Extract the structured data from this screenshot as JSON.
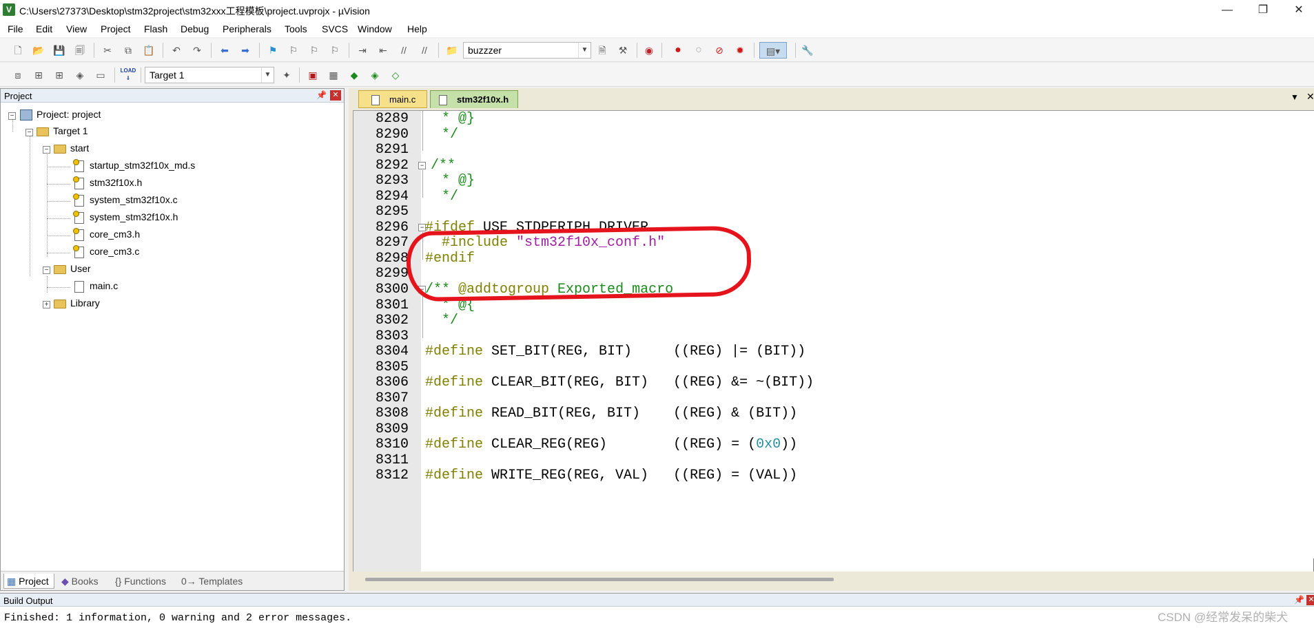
{
  "window": {
    "title": "C:\\Users\\27373\\Desktop\\stm32project\\stm32xxx工程模板\\project.uvprojx - µVision",
    "app_icon": "V",
    "controls": [
      "—",
      "❐",
      "✕"
    ]
  },
  "menu": [
    "File",
    "Edit",
    "View",
    "Project",
    "Flash",
    "Debug",
    "Peripherals",
    "Tools",
    "SVCS",
    "Window",
    "Help"
  ],
  "toolbar1": {
    "find_value": "buzzzer"
  },
  "toolbar2": {
    "target_value": "Target 1",
    "load_label": "LOAD"
  },
  "project_pane": {
    "title": "Project",
    "tree": {
      "root": "Project: project",
      "target": "Target 1",
      "groups": [
        {
          "name": "start",
          "files": [
            "startup_stm32f10x_md.s",
            "stm32f10x.h",
            "system_stm32f10x.c",
            "system_stm32f10x.h",
            "core_cm3.h",
            "core_cm3.c"
          ]
        },
        {
          "name": "User",
          "files": [
            "main.c"
          ]
        },
        {
          "name": "Library",
          "files": []
        }
      ]
    },
    "tabs": [
      "Project",
      "Books",
      "{} Functions",
      "0→ Templates"
    ]
  },
  "editor": {
    "tabs": [
      "main.c",
      "stm32f10x.h"
    ],
    "active_tab": "stm32f10x.h",
    "line_numbers": [
      "8289",
      "8290",
      "8291",
      "8292",
      "8293",
      "8294",
      "8295",
      "8296",
      "8297",
      "8298",
      "8299",
      "8300",
      "8301",
      "8302",
      "8303",
      "8304",
      "8305",
      "8306",
      "8307",
      "8308",
      "8309",
      "8310",
      "8311",
      "8312"
    ],
    "lines": {
      "l8289": "  * @}",
      "l8290": "  */",
      "l8292": "/**",
      "l8293": "  * @}",
      "l8294": "  */",
      "l8296_pp": "#ifdef",
      "l8296_id": " USE_STDPERIPH_DRIVER",
      "l8297_pp": "  #include",
      "l8297_str": " \"stm32f10x_conf.h\"",
      "l8298_pp": "#endif",
      "l8300_cm": "/** ",
      "l8300_tag": "@addtogroup",
      "l8300_rest": " Exported_macro",
      "l8301": "  * @{",
      "l8302": "  */",
      "l8304_pp": "#define",
      "l8304_id": " SET_BIT(REG, BIT)     ((REG) |= (BIT))",
      "l8306_pp": "#define",
      "l8306_id": " CLEAR_BIT(REG, BIT)   ((REG) &= ~(BIT))",
      "l8308_pp": "#define",
      "l8308_id": " READ_BIT(REG, BIT)    ((REG) & (BIT))",
      "l8310_pp": "#define",
      "l8310_id": " CLEAR_REG(REG)        ((REG) = (",
      "l8310_num": "0x0",
      "l8310_end": "))",
      "l8312_pp": "#define",
      "l8312_id": " WRITE_REG(REG, VAL)   ((REG) = (VAL))"
    }
  },
  "build_output": {
    "title": "Build Output",
    "message": "Finished: 1 information, 0 warning and 2 error messages."
  },
  "watermark": "CSDN @经常发呆的柴犬",
  "colors": {
    "comment": "#1a8a1a",
    "preprocessor": "#808000",
    "string": "#a020a0",
    "number": "#2a8fa0",
    "annotation_circle": "#e5141c"
  }
}
